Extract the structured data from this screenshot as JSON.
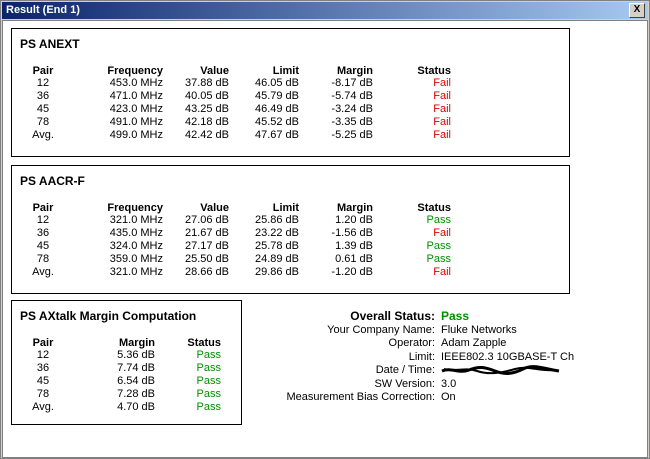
{
  "window": {
    "title": "Result (End 1)",
    "close_label": "X"
  },
  "anext": {
    "title": "PS ANEXT",
    "headers": [
      "Pair",
      "Frequency",
      "Value",
      "Limit",
      "Margin",
      "Status"
    ],
    "rows": [
      [
        "12",
        "453.0 MHz",
        "37.88 dB",
        "46.05 dB",
        "-8.17 dB",
        "Fail"
      ],
      [
        "36",
        "471.0 MHz",
        "40.05 dB",
        "45.79 dB",
        "-5.74 dB",
        "Fail"
      ],
      [
        "45",
        "423.0 MHz",
        "43.25 dB",
        "46.49 dB",
        "-3.24 dB",
        "Fail"
      ],
      [
        "78",
        "491.0 MHz",
        "42.18 dB",
        "45.52 dB",
        "-3.35 dB",
        "Fail"
      ],
      [
        "Avg.",
        "499.0 MHz",
        "42.42 dB",
        "47.67 dB",
        "-5.25 dB",
        "Fail"
      ]
    ]
  },
  "aacrf": {
    "title": "PS AACR-F",
    "headers": [
      "Pair",
      "Frequency",
      "Value",
      "Limit",
      "Margin",
      "Status"
    ],
    "rows": [
      [
        "12",
        "321.0 MHz",
        "27.06 dB",
        "25.86 dB",
        "1.20 dB",
        "Pass"
      ],
      [
        "36",
        "435.0 MHz",
        "21.67 dB",
        "23.22 dB",
        "-1.56 dB",
        "Fail"
      ],
      [
        "45",
        "324.0 MHz",
        "27.17 dB",
        "25.78 dB",
        "1.39 dB",
        "Pass"
      ],
      [
        "78",
        "359.0 MHz",
        "25.50 dB",
        "24.89 dB",
        "0.61 dB",
        "Pass"
      ],
      [
        "Avg.",
        "321.0 MHz",
        "28.66 dB",
        "29.86 dB",
        "-1.20 dB",
        "Fail"
      ]
    ]
  },
  "axtalk": {
    "title": "PS AXtalk Margin Computation",
    "headers": [
      "Pair",
      "Margin",
      "Status"
    ],
    "rows": [
      [
        "12",
        "5.36 dB",
        "Pass"
      ],
      [
        "36",
        "7.74 dB",
        "Pass"
      ],
      [
        "45",
        "6.54 dB",
        "Pass"
      ],
      [
        "78",
        "7.28 dB",
        "Pass"
      ],
      [
        "Avg.",
        "4.70 dB",
        "Pass"
      ]
    ]
  },
  "summary": {
    "overall_label": "Overall Status:",
    "overall_value": "Pass",
    "company_label": "Your Company Name:",
    "company_value": "Fluke Networks",
    "operator_label": "Operator:",
    "operator_value": "Adam Zapple",
    "limit_label": "Limit:",
    "limit_value": "IEEE802.3 10GBASE-T Ch",
    "datetime_label": "Date / Time:",
    "sw_label": "SW Version:",
    "sw_value": "3.0",
    "bias_label": "Measurement Bias Correction:",
    "bias_value": "On"
  },
  "colors": {
    "fail": "#e00000",
    "pass": "#009000",
    "titlebar": "#0a246a"
  }
}
